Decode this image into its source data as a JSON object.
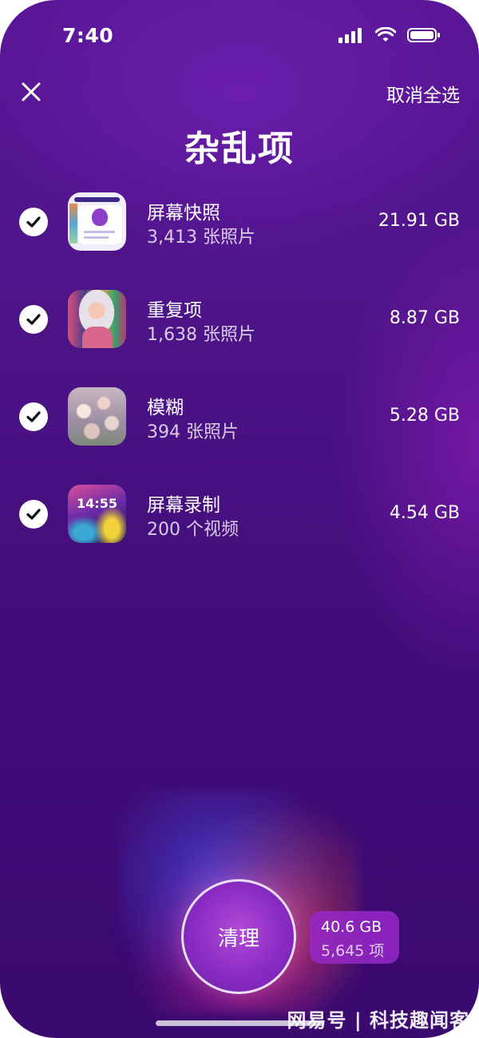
{
  "status_bar": {
    "time": "7:40"
  },
  "header": {
    "close_icon": "close-icon",
    "deselect_all_label": "取消全选",
    "title": "杂乱项"
  },
  "items": [
    {
      "title": "屏幕快照",
      "subtitle": "3,413 张照片",
      "size": "21.91 GB",
      "checked": true
    },
    {
      "title": "重复项",
      "subtitle": "1,638 张照片",
      "size": "8.87 GB",
      "checked": true
    },
    {
      "title": "模糊",
      "subtitle": "394 张照片",
      "size": "5.28 GB",
      "checked": true
    },
    {
      "title": "屏幕录制",
      "subtitle": "200 个视频",
      "size": "4.54 GB",
      "checked": true
    }
  ],
  "thumbnails": {
    "record_clock": "14:55"
  },
  "footer": {
    "clean_label": "清理",
    "total_size": "40.6 GB",
    "total_count": "5,645 项"
  },
  "watermark": "网易号 | 科技趣闻客",
  "colors": {
    "background": "#4d1488",
    "accent": "#8a2bc4",
    "text": "#ffffff"
  }
}
